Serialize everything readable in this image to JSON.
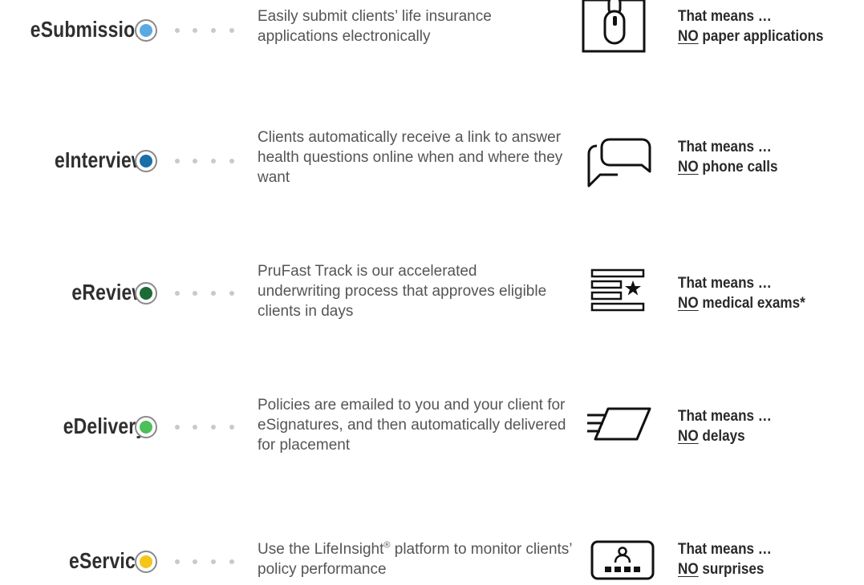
{
  "rows": [
    {
      "name": "eSubmission",
      "dot_color": "#5aa9e3",
      "description": "Easily submit clients’ life insurance applications electronically",
      "icon": "mouse-tablet-icon",
      "means_prefix": "That means …",
      "no": "NO",
      "means_rest": "paper applications"
    },
    {
      "name": "eInterview",
      "dot_color": "#1a6fa8",
      "description": "Clients automatically receive a link to answer health questions online when and where they want",
      "icon": "chat-bubbles-icon",
      "means_prefix": "That means …",
      "no": "NO",
      "means_rest": "phone calls"
    },
    {
      "name": "eReview",
      "dot_color": "#1c6b36",
      "description": "PruFast Track is our accelerated underwriting process that approves eligible clients in days",
      "icon": "list-star-icon",
      "means_prefix": "That means …",
      "no": "NO",
      "means_rest": "medical exams*"
    },
    {
      "name": "eDelivery",
      "dot_color": "#4cbf5a",
      "description": "Policies are emailed to you and your client for eSignatures, and then automatically delivered for placement",
      "icon": "fast-document-icon",
      "means_prefix": "That means …",
      "no": "NO",
      "means_rest": "delays"
    },
    {
      "name": "eService",
      "dot_color": "#f5c518",
      "description_pre": "Use the LifeInsight",
      "description_sup": "®",
      "description_post": " platform to monitor clients’ policy performance",
      "icon": "person-dashboard-icon",
      "means_prefix": "That means …",
      "no": "NO",
      "means_rest": "surprises"
    }
  ]
}
